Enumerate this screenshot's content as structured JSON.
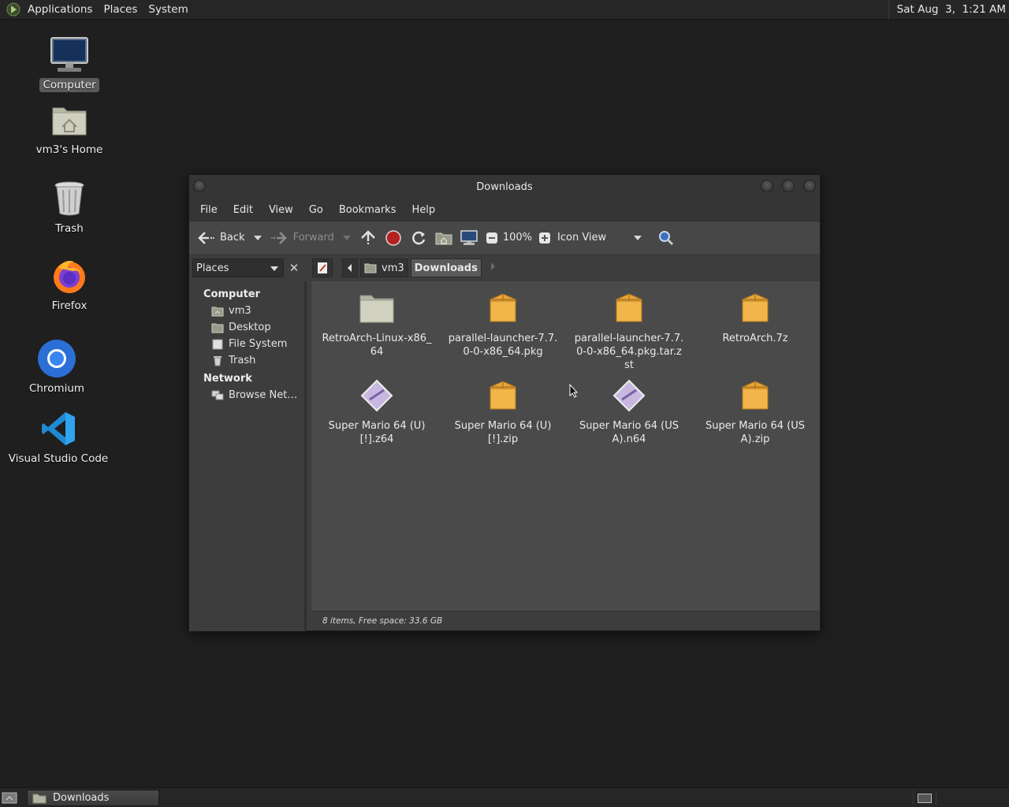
{
  "top_panel": {
    "menus": [
      "Applications",
      "Places",
      "System"
    ],
    "clock": "Sat Aug  3,  1:21 AM"
  },
  "desktop": {
    "icons": [
      {
        "label": "Computer",
        "icon": "computer-icon"
      },
      {
        "label": "vm3's Home",
        "icon": "home-folder-icon"
      },
      {
        "label": "Trash",
        "icon": "trash-icon"
      },
      {
        "label": "Firefox",
        "icon": "firefox-icon"
      },
      {
        "label": "Chromium",
        "icon": "chromium-icon"
      },
      {
        "label": "Visual Studio Code",
        "icon": "vscode-icon"
      }
    ]
  },
  "window": {
    "title": "Downloads",
    "menu": [
      "File",
      "Edit",
      "View",
      "Go",
      "Bookmarks",
      "Help"
    ],
    "toolbar": {
      "back": "Back",
      "forward": "Forward",
      "zoom": "100%",
      "view_mode": "Icon View"
    },
    "location": {
      "places_label": "Places",
      "crumbs": [
        "vm3",
        "Downloads"
      ]
    },
    "sidebar": {
      "computer_header": "Computer",
      "computer_items": [
        "vm3",
        "Desktop",
        "File System",
        "Trash"
      ],
      "network_header": "Network",
      "network_items": [
        "Browse Net…"
      ]
    },
    "files": [
      {
        "name": "RetroArch-Linux-x86_64",
        "icon": "folder-icon"
      },
      {
        "name": "parallel-launcher-7.7.0-0-x86_64.pkg",
        "icon": "package-icon"
      },
      {
        "name": "parallel-launcher-7.7.0-0-x86_64.pkg.tar.zst",
        "icon": "package-icon"
      },
      {
        "name": "RetroArch.7z",
        "icon": "package-icon"
      },
      {
        "name": "Super Mario 64 (U) [!].z64",
        "icon": "rom-file-icon"
      },
      {
        "name": "Super Mario 64 (U) [!].zip",
        "icon": "package-icon"
      },
      {
        "name": "Super Mario 64 (USA).n64",
        "icon": "rom-file-icon"
      },
      {
        "name": "Super Mario 64 (USA).zip",
        "icon": "package-icon"
      }
    ],
    "status": "8 items, Free space: 33.6 GB"
  },
  "bottom_panel": {
    "task": "Downloads"
  }
}
